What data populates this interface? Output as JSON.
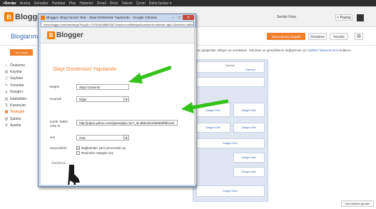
{
  "google_bar": {
    "items": [
      "+Serdar",
      "Arama",
      "Görseller",
      "Haritalar",
      "Play",
      "Haberler",
      "Gmail",
      "Drive",
      "Takvim",
      "Çeviri",
      "Daha fazlası ▾"
    ]
  },
  "header": {
    "logo_letter": "B",
    "logo_text": "Blogger",
    "user_name": "Serdar Kara",
    "share_label": "+ Paylaş"
  },
  "page": {
    "title": "Bloglarım",
    "save_label": "Düzenlemeyi kaydet",
    "preview_label": "Önizleme",
    "clear_label": "Temizle"
  },
  "sidebar": {
    "new_post_label": "Yeni yayın",
    "items": [
      {
        "label": "Önizleme",
        "icon": "home-icon"
      },
      {
        "label": "Kayıtlar",
        "icon": "posts-icon"
      },
      {
        "label": "Sayfalar",
        "icon": "pages-icon"
      },
      {
        "label": "Yorumlar",
        "icon": "comments-icon"
      },
      {
        "label": "Google+",
        "icon": "googleplus-icon"
      },
      {
        "label": "İstatistikler",
        "icon": "stats-icon"
      },
      {
        "label": "Kazançlar",
        "icon": "earnings-icon"
      },
      {
        "label": "Yerleşim",
        "icon": "layout-icon"
      },
      {
        "label": "Şablon",
        "icon": "template-icon"
      },
      {
        "label": "Ayarlar",
        "icon": "settings-icon"
      }
    ],
    "active_index": 7
  },
  "layout_area": {
    "hint_text": "i ve gadget'ları tıklayın ve sürükleyin. Sütunları ve genişliklerini değiştirmek için",
    "hint_link": "Şablon Tasarımcısı'nı",
    "hint_tail": "kullanın.",
    "navbar_label": "Navbar",
    "edit_label": "Düzenle",
    "gadget_add_label": "Gadget Ekle"
  },
  "popup": {
    "window_title": "Blogger: Blog Hocam Test - Slayt Gösterisini Yapılandır - Google Chrome",
    "url": "www.blogger.com/rearrange?blogID=7976316486852827&action=editWidget&sectionId=sidebar-right-1&section=addWidg",
    "logo_letter": "B",
    "logo_text": "Blogger",
    "dialog_title": "Slayt Gösterisini Yapılandır",
    "fields": {
      "title_label": "Başlık",
      "title_value": "Slayt Gösterisi",
      "source_label": "Kaynak",
      "source_value": "Diğer",
      "feed_label": "İçerik Takibi URL'si",
      "feed_value": "http://pipes.yahoo.com/pipes/pipe.run?_id=856c524266680f8fece6",
      "speed_label": "Hız",
      "speed_value": "Orta",
      "options_label": "Seçenekler",
      "option1_label": "Bağlantıları yeni pencerede aç",
      "option1_checked": true,
      "option2_label": "Resimleri rastgele seç",
      "option2_checked": false,
      "preview_label": "Önizleme"
    }
  },
  "feedback_label": "Geri bildirim gönder",
  "colors": {
    "accent_orange": "#f07e2a",
    "link_blue": "#3d6bb6",
    "arrow_green": "#34c21a"
  }
}
